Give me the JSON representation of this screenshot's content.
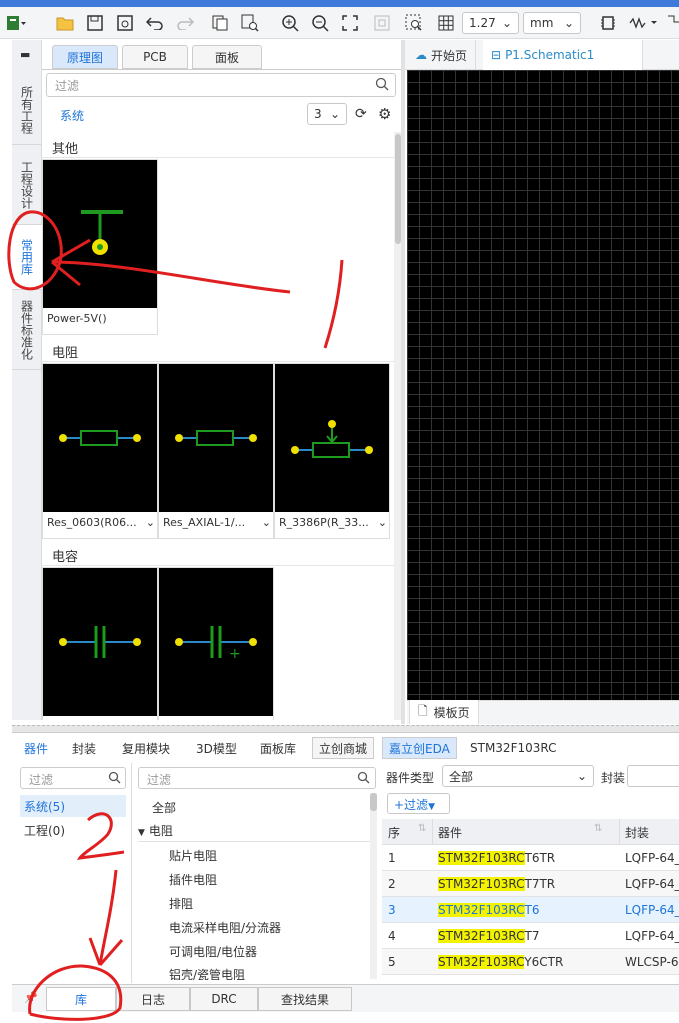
{
  "toolbar": {
    "grid_size": "1.27",
    "unit": "mm",
    "icons": [
      "logo-icon",
      "folder-icon",
      "save-icon",
      "save-as-icon",
      "undo-icon",
      "redo-icon",
      "copy-icon",
      "find-icon",
      "zoom-in-icon",
      "zoom-out-icon",
      "fit-icon",
      "fit-selection-icon",
      "zoom-area-icon",
      "grid-icon",
      "chip-icon",
      "wave-icon"
    ]
  },
  "vertical_tabs": [
    {
      "label": "所有工程"
    },
    {
      "label": "工程设计"
    },
    {
      "label": "常用库"
    },
    {
      "label": "器件标准化"
    }
  ],
  "panel_tabs": [
    {
      "label": "原理图"
    },
    {
      "label": "PCB"
    },
    {
      "label": "面板"
    }
  ],
  "library": {
    "filter_placeholder": "过滤",
    "source": "系统",
    "columns_value": "3",
    "categories": [
      {
        "name": "其他",
        "items": [
          {
            "label": "Power-5V()"
          }
        ]
      },
      {
        "name": "电阻",
        "items": [
          {
            "label": "Res_0603(R06..."
          },
          {
            "label": "Res_AXIAL-1/..."
          },
          {
            "label": "R_3386P(R_33..."
          }
        ]
      },
      {
        "name": "电容",
        "items": [
          {
            "label": ""
          },
          {
            "label": ""
          }
        ]
      }
    ]
  },
  "canvas": {
    "tabs": [
      {
        "label": "开始页"
      },
      {
        "label": "P1.Schematic1"
      }
    ],
    "bottom_tab": "模板页"
  },
  "bottom_panel": {
    "tabs": [
      {
        "label": "器件"
      },
      {
        "label": "封装"
      },
      {
        "label": "复用模块"
      },
      {
        "label": "3D模型"
      },
      {
        "label": "面板库"
      },
      {
        "label": "立创商城"
      },
      {
        "label": "嘉立创EDA"
      },
      {
        "label": "STM32F103RC"
      }
    ],
    "left_filter": "过滤",
    "sources": [
      {
        "label": "系统(5)"
      },
      {
        "label": "工程(0)"
      }
    ],
    "tree_filter": "过滤",
    "tree": [
      {
        "label": "全部"
      },
      {
        "label": "电阻"
      },
      {
        "label": "贴片电阻"
      },
      {
        "label": "插件电阻"
      },
      {
        "label": "排阻"
      },
      {
        "label": "电流采样电阻/分流器"
      },
      {
        "label": "可调电阻/电位器"
      },
      {
        "label": "铝壳/瓷管电阻"
      }
    ],
    "device_type_label": "器件类型",
    "device_type_value": "全部",
    "package_label": "封装",
    "filter_button": "+过滤",
    "table_headers": {
      "seq": "序",
      "device": "器件",
      "package": "封装"
    },
    "rows": [
      {
        "seq": "1",
        "hl": "STM32F103RC",
        "rest": "T6TR",
        "package": "LQFP-64_"
      },
      {
        "seq": "2",
        "hl": "STM32F103RC",
        "rest": "T7TR",
        "package": "LQFP-64_"
      },
      {
        "seq": "3",
        "hl": "STM32F103RC",
        "rest": "T6",
        "package": "LQFP-64_"
      },
      {
        "seq": "4",
        "hl": "STM32F103RC",
        "rest": "T7",
        "package": "LQFP-64_"
      },
      {
        "seq": "5",
        "hl": "STM32F103RC",
        "rest": "Y6CTR",
        "package": "WLCSP-6"
      }
    ]
  },
  "status_tabs": [
    {
      "label": "库"
    },
    {
      "label": "日志"
    },
    {
      "label": "DRC"
    },
    {
      "label": "查找结果"
    }
  ],
  "colors": {
    "accent": "#1e74d8",
    "highlight": "#f3f300",
    "annotation": "#e02020"
  }
}
